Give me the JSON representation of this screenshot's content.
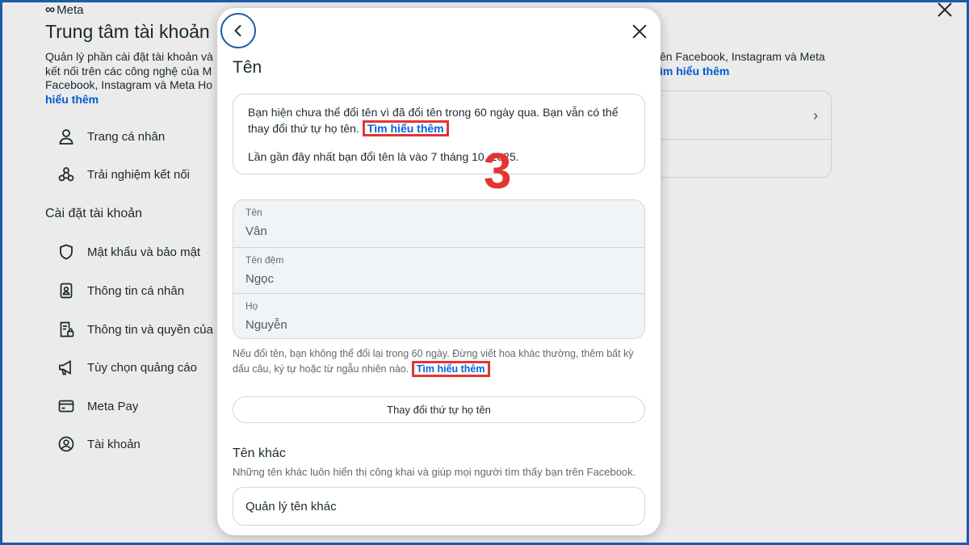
{
  "background": {
    "brand": "Meta",
    "title": "Trung tâm tài khoản",
    "description_lines": [
      "Quản lý phần cài đặt tài khoản và",
      "kết nối trên các công nghệ của M",
      "Facebook, Instagram và Meta Ho"
    ],
    "description_link": "hiểu thêm",
    "nav_items": [
      {
        "label": "Trang cá nhân",
        "icon": "person-icon"
      },
      {
        "label": "Trải nghiệm kết nối",
        "icon": "connected-experiences-icon"
      }
    ],
    "settings_heading": "Cài đặt tài khoản",
    "settings_items": [
      {
        "label": "Mật khẩu và bảo mật",
        "icon": "shield-icon"
      },
      {
        "label": "Thông tin cá nhân",
        "icon": "id-card-icon"
      },
      {
        "label": "Thông tin và quyền của b",
        "icon": "document-lock-icon"
      },
      {
        "label": "Tùy chọn quảng cáo",
        "icon": "megaphone-icon"
      },
      {
        "label": "Meta Pay",
        "icon": "credit-card-icon"
      },
      {
        "label": "Tài khoản",
        "icon": "account-circle-icon"
      }
    ],
    "right_text_line1": "ên Facebook, Instagram và Meta",
    "right_text_link": "ìm hiểu thêm"
  },
  "modal": {
    "title": "Tên",
    "notice_text": "Bạn hiện chưa thể đổi tên vì đã đổi tên trong 60 ngày qua. Bạn vẫn có thể thay đổi thứ tự họ tên.",
    "notice_link": "Tìm hiểu thêm",
    "last_change_text": "Lần gần đây nhất bạn đổi tên là vào 7 tháng 10, 2025.",
    "step_number": "3",
    "fields": [
      {
        "label": "Tên",
        "value": "Vân"
      },
      {
        "label": "Tên đệm",
        "value": "Ngọc"
      },
      {
        "label": "Họ",
        "value": "Nguyễn"
      }
    ],
    "note_text": "Nếu đổi tên, bạn không thể đổi lại trong 60 ngày. Đừng viết hoa khác thường, thêm bất kỳ dấu câu, ký tự hoặc từ ngẫu nhiên nào.",
    "note_link": "Tìm hiểu thêm",
    "change_order_button": "Thay đổi thứ tự họ tên",
    "other_names_title": "Tên khác",
    "other_names_desc": "Những tên khác luôn hiển thị công khai và giúp mọi người tìm thấy bạn trên Facebook.",
    "manage_other_names": "Quản lý tên khác"
  },
  "colors": {
    "link": "#0064e0",
    "highlight": "#e5342f",
    "frame": "#1f5aa8"
  }
}
